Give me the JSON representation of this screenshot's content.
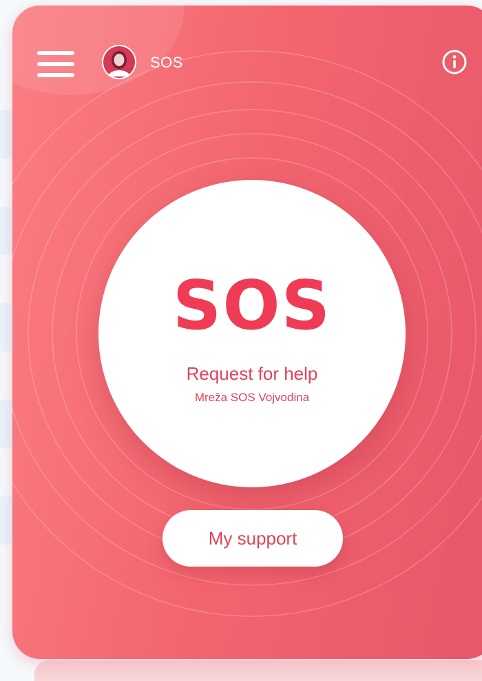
{
  "header": {
    "title": "SOS",
    "menu_icon": "hamburger-menu-icon",
    "avatar_icon": "user-avatar-icon",
    "info_icon": "info-icon"
  },
  "sos_button": {
    "title": "SOS",
    "subtitle": "Request for help",
    "network": "Mreža SOS Vojvodina"
  },
  "support_button": {
    "label": "My support"
  },
  "colors": {
    "accent": "#f3666f",
    "sos_text": "#ef3b53",
    "button_text": "#e04358",
    "background": "#f6f9fc"
  }
}
